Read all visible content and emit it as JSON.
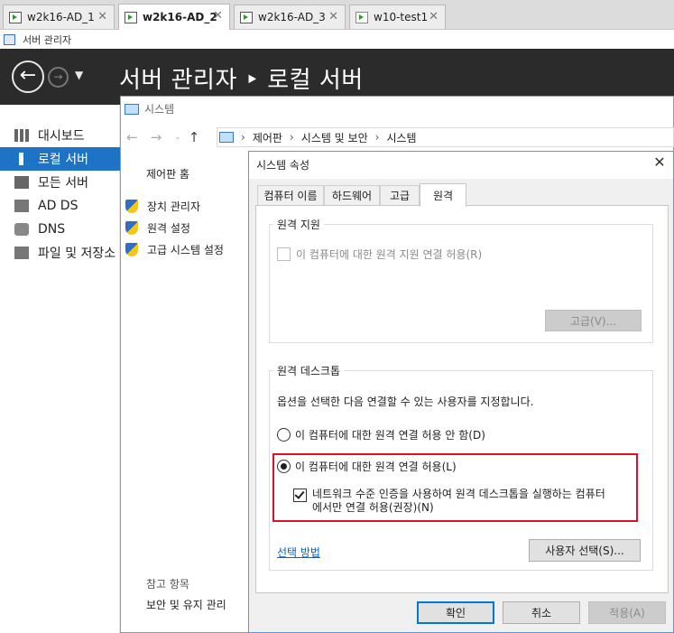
{
  "vm_tabs": [
    {
      "label": "w2k16-AD_1",
      "active": false
    },
    {
      "label": "w2k16-AD_2",
      "active": true
    },
    {
      "label": "w2k16-AD_3",
      "active": false
    },
    {
      "label": "w10-test1",
      "active": false
    }
  ],
  "server_manager": {
    "window_title": "서버 관리자",
    "header_title": "서버 관리자 ‣ 로컬 서버"
  },
  "left_nav": {
    "items": [
      {
        "label": "대시보드",
        "icon": "dashboard-icon",
        "selected": false
      },
      {
        "label": "로컬 서버",
        "icon": "local-server-icon",
        "selected": true
      },
      {
        "label": "모든 서버",
        "icon": "all-servers-icon",
        "selected": false
      },
      {
        "label": "AD DS",
        "icon": "ad-ds-icon",
        "selected": false
      },
      {
        "label": "DNS",
        "icon": "dns-icon",
        "selected": false
      },
      {
        "label": "파일 및 저장소",
        "icon": "file-storage-icon",
        "selected": false
      }
    ]
  },
  "system_window": {
    "title": "시스템",
    "breadcrumb": [
      "제어판",
      "시스템 및 보안",
      "시스템"
    ],
    "control_panel_home": "제어판 홈",
    "links": [
      "장치 관리자",
      "원격 설정",
      "고급 시스템 설정"
    ],
    "see_also": "참고 항목",
    "see_also_item": "보안 및 유지 관리"
  },
  "dialog": {
    "title": "시스템 속성",
    "tabs": [
      "컴퓨터 이름",
      "하드웨어",
      "고급",
      "원격"
    ],
    "active_tab": "원격",
    "remote_assistance": {
      "group_label": "원격 지원",
      "checkbox_label": "이 컴퓨터에 대한 원격 지원 연결 허용(R)",
      "checkbox_checked": false,
      "advanced_button": "고급(V)..."
    },
    "remote_desktop": {
      "group_label": "원격 데스크톱",
      "instruction": "옵션을 선택한 다음 연결할 수 있는 사용자를 지정합니다.",
      "option_deny": "이 컴퓨터에 대한 원격 연결 허용 안 함(D)",
      "option_allow": "이 컴퓨터에 대한 원격 연결 허용(L)",
      "selected_option": "allow",
      "nla_line1": "네트워크 수준 인증을 사용하여 원격 데스크톱을 실행하는 컴퓨터",
      "nla_line2": "에서만 연결 허용(권장)(N)",
      "nla_checked": true,
      "help_link": "선택 방법",
      "select_users_button": "사용자 선택(S)..."
    },
    "buttons": {
      "ok": "확인",
      "cancel": "취소",
      "apply": "적용(A)"
    },
    "highlight_color": "#e0102a"
  }
}
